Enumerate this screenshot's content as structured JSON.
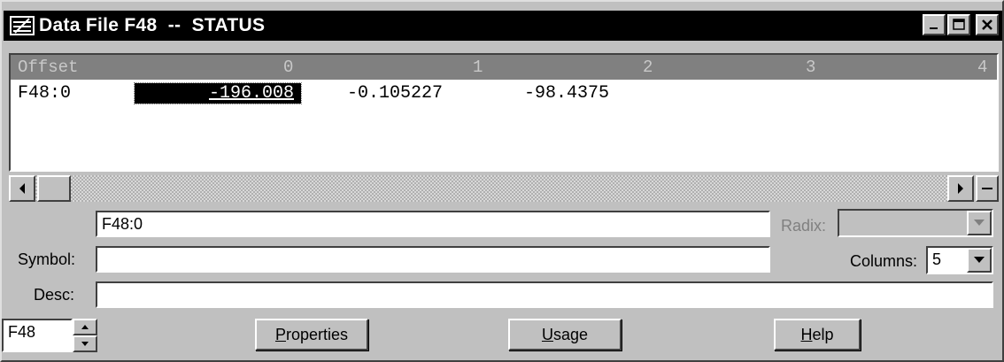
{
  "window": {
    "title": "Data File F48  --  STATUS",
    "icon": "data-file-icon",
    "controls": [
      "minimize-icon",
      "maximize-icon",
      "close-icon"
    ]
  },
  "grid": {
    "headers": [
      "Offset",
      "0",
      "1",
      "2",
      "3",
      "4"
    ],
    "rows": [
      {
        "offset": "F48:0",
        "values": [
          "-196.008",
          "-0.105227",
          "-98.4375",
          "",
          ""
        ]
      }
    ],
    "selected_cell": "0"
  },
  "form": {
    "address_value": "F48:0",
    "radix_label": "Radix:",
    "radix_value": "",
    "symbol_label": "Symbol:",
    "symbol_value": "",
    "columns_label": "Columns:",
    "columns_value": "5",
    "desc_label": "Desc:",
    "desc_value": "",
    "file_value": "F48"
  },
  "buttons": {
    "properties": {
      "mnemonic": "P",
      "rest": "roperties"
    },
    "usage": {
      "mnemonic": "U",
      "rest": "sage"
    },
    "help": {
      "mnemonic": "H",
      "rest": "elp"
    }
  },
  "colors": {
    "titlebar_bg": "#000000",
    "header_bg": "#808080",
    "window_bg": "#c0c0c0",
    "selection_bg": "#000000"
  }
}
